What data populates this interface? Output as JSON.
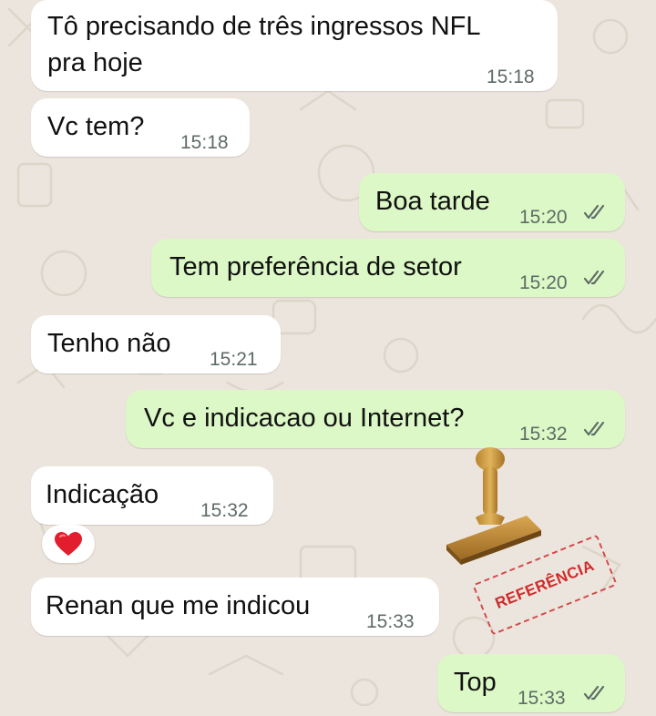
{
  "messages": [
    {
      "id": "m1",
      "dir": "in",
      "lines": [
        "Tô precisando de três ingressos NFL",
        "pra hoje"
      ],
      "time": "15:18"
    },
    {
      "id": "m2",
      "dir": "in",
      "text": "Vc tem?",
      "time": "15:18"
    },
    {
      "id": "m3",
      "dir": "out",
      "text": "Boa tarde",
      "time": "15:20",
      "status": "read"
    },
    {
      "id": "m4",
      "dir": "out",
      "text": "Tem preferência de setor",
      "time": "15:20",
      "status": "read"
    },
    {
      "id": "m5",
      "dir": "in",
      "text": "Tenho não",
      "time": "15:21"
    },
    {
      "id": "m6",
      "dir": "out",
      "text": "Vc e indicacao ou Internet?",
      "time": "15:32",
      "status": "read"
    },
    {
      "id": "m7",
      "dir": "in",
      "text": "Indicação",
      "time": "15:32",
      "reaction": "red-heart"
    },
    {
      "id": "m8",
      "dir": "in",
      "text": "Renan que me indicou",
      "time": "15:33"
    },
    {
      "id": "m9",
      "dir": "out",
      "text": "Top",
      "time": "15:33",
      "status": "read"
    }
  ],
  "overlay": {
    "stamp_label": "REFERÊNCIA",
    "stamp_icon": "rubber-stamp-icon",
    "stamp_color": "#cf2b2b"
  },
  "colors": {
    "wallpaper": "#ece5dd",
    "incoming_bubble": "#ffffff",
    "outgoing_bubble": "#dcf8c6",
    "read_ticks": "#5f6b66"
  }
}
